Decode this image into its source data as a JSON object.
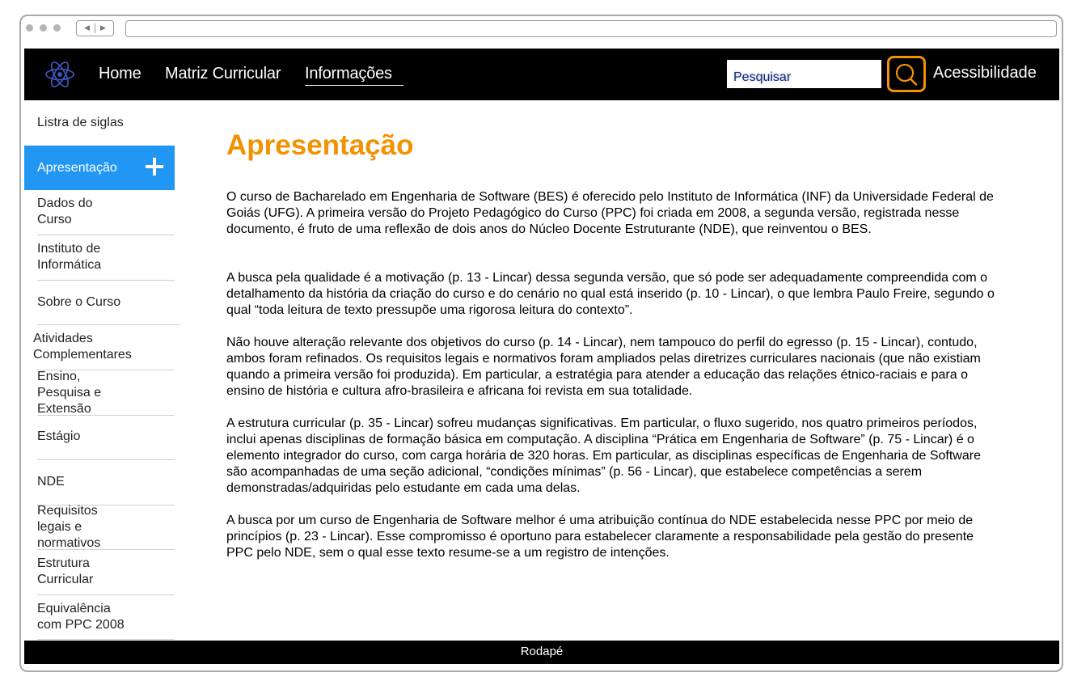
{
  "nav": {
    "logo_icon": "atom-icon",
    "links": [
      "Home",
      "Matriz Curricular",
      "Informações"
    ],
    "active_link": "Informações",
    "search_placeholder": "Pesquisar",
    "search_icon": "search-icon",
    "accessibility_label": "Acessibilidade"
  },
  "sidebar": {
    "items": [
      {
        "label": "Listra de siglas"
      },
      {
        "label": "Apresentação",
        "active": true
      },
      {
        "label": "Dados do\nCurso"
      },
      {
        "label": "Instituto de\nInformática"
      },
      {
        "label": "Sobre o Curso"
      },
      {
        "label": "Atividades\nComplementares"
      },
      {
        "label": "Ensino,\nPesquisa e\nExtensão"
      },
      {
        "label": "Estágio"
      },
      {
        "label": "NDE"
      },
      {
        "label": "Requisitos\nlegais e\nnormativos"
      },
      {
        "label": "Estrutura\nCurricular"
      },
      {
        "label": "Equivalência\ncom PPC 2008"
      }
    ],
    "expand_icon": "plus-icon"
  },
  "main": {
    "title": "Apresentação",
    "paragraphs": [
      "O curso de Bacharelado em Engenharia de Software (BES) é oferecido pelo Instituto de Informática (INF) da Universidade Federal de Goiás (UFG). A primeira versão do Projeto Pedagógico do Curso (PPC) foi criada em 2008, a segunda versão, registrada nesse documento, é fruto de uma reflexão de dois anos do Núcleo Docente Estruturante (NDE), que reinventou o BES.",
      "A busca pela qualidade é a motivação (p. 13 - Lincar) dessa segunda versão, que só pode ser adequadamente compreendida com o detalhamento da história da criação do curso e do cenário no qual está inserido (p. 10 - Lincar), o que lembra Paulo Freire, segundo o qual “toda leitura de texto pressupõe uma rigorosa leitura do contexto”.",
      "Não houve alteração relevante dos objetivos do curso (p. 14 - Lincar), nem tampouco do perfil do egresso (p. 15 - Lincar), contudo, ambos foram refinados. Os requisitos legais e normativos foram ampliados pelas diretrizes curriculares nacionais (que não existiam quando a primeira versão foi produzida). Em particular, a estratégia para atender a educação das relações étnico-raciais e para o ensino de história e cultura afro-brasileira e africana foi revista em sua totalidade.",
      "A estrutura curricular (p. 35 - Lincar) sofreu mudanças significativas. Em particular, o fluxo sugerido, nos quatro primeiros períodos, inclui apenas disciplinas de formação básica em computação. A disciplina “Prática em Engenharia de Software” (p. 75 - Lincar) é o elemento integrador do curso, com carga horária de 320 horas. Em particular, as disciplinas específicas de Engenharia de Software são acompanhadas de uma seção adicional, “condições mínimas” (p. 56 - Lincar), que estabelece competências a serem demonstradas/adquiridas pelo estudante em cada uma delas.",
      "A busca por um curso de Engenharia de Software melhor é uma atribuição contínua do NDE estabelecida nesse PPC por meio de princípios (p. 23 - Lincar). Esse compromisso é oportuno para estabelecer claramente a responsabilidade pela gestão do presente PPC pelo NDE, sem o qual esse texto resume-se a um registro de intenções."
    ]
  },
  "footer": {
    "label": "Rodapé"
  },
  "colors": {
    "accent_orange": "#f39200",
    "active_blue": "#2196f3",
    "nav_bg": "#000000",
    "logo_blue": "#3f51b5"
  }
}
